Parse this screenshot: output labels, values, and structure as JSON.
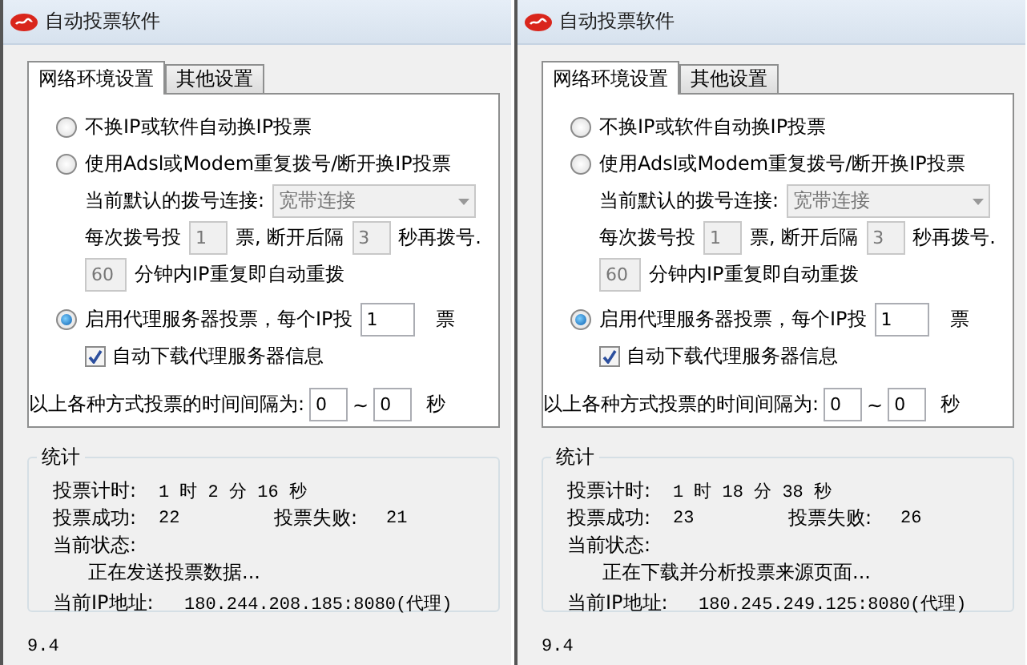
{
  "windows": [
    {
      "title": "自动投票软件",
      "tabs": [
        {
          "label": "网络环境设置",
          "selected": true
        },
        {
          "label": "其他设置",
          "selected": false
        }
      ],
      "no_change_option": {
        "label": "不换IP或软件自动换IP投票",
        "selected": false
      },
      "dialup_option": {
        "label": "使用Adsl或Modem重复拨号/断开换IP投票",
        "selected": false,
        "connection_label": "当前默认的拨号连接:",
        "connection": {
          "value": "宽带连接",
          "disabled": true
        },
        "votes_label": "每次拨号投",
        "votes": {
          "value": "1",
          "disabled": true
        },
        "after_label": "票, 断开后隔",
        "wait": {
          "value": "3",
          "disabled": true
        },
        "wait_label": "秒再拨号.",
        "repeat": {
          "value": "60",
          "disabled": true
        },
        "repeat_label": "分钟内IP重复即自动重拨"
      },
      "proxy_option": {
        "label": "启用代理服务器投票，每个IP投",
        "selected": true,
        "votes": {
          "value": "1",
          "disabled": false
        },
        "votes_unit": "票",
        "auto_download": {
          "label": "自动下载代理服务器信息",
          "checked": true
        }
      },
      "interval": {
        "label": "以上各种方式投票的时间间隔为:",
        "min": "0",
        "separator": "~",
        "max": "0",
        "unit": "秒"
      },
      "stats": {
        "title": "统计",
        "time_label": "投票计时:",
        "time_value": "1 时 2 分 16 秒",
        "success_label": "投票成功:",
        "success_value": "22",
        "fail_label": "投票失败:",
        "fail_value": "21",
        "status_label": "当前状态:",
        "status_value": "正在发送投票数据...",
        "ip_label": "当前IP地址:",
        "ip_value": "180.244.208.185:8080(代理)"
      },
      "version": "9.4"
    },
    {
      "title": "自动投票软件",
      "tabs": [
        {
          "label": "网络环境设置",
          "selected": true
        },
        {
          "label": "其他设置",
          "selected": false
        }
      ],
      "no_change_option": {
        "label": "不换IP或软件自动换IP投票",
        "selected": false
      },
      "dialup_option": {
        "label": "使用Adsl或Modem重复拨号/断开换IP投票",
        "selected": false,
        "connection_label": "当前默认的拨号连接:",
        "connection": {
          "value": "宽带连接",
          "disabled": true
        },
        "votes_label": "每次拨号投",
        "votes": {
          "value": "1",
          "disabled": true
        },
        "after_label": "票, 断开后隔",
        "wait": {
          "value": "3",
          "disabled": true
        },
        "wait_label": "秒再拨号.",
        "repeat": {
          "value": "60",
          "disabled": true
        },
        "repeat_label": "分钟内IP重复即自动重拨"
      },
      "proxy_option": {
        "label": "启用代理服务器投票，每个IP投",
        "selected": true,
        "votes": {
          "value": "1",
          "disabled": false
        },
        "votes_unit": "票",
        "auto_download": {
          "label": "自动下载代理服务器信息",
          "checked": true
        }
      },
      "interval": {
        "label": "以上各种方式投票的时间间隔为:",
        "min": "0",
        "separator": "~",
        "max": "0",
        "unit": "秒"
      },
      "stats": {
        "title": "统计",
        "time_label": "投票计时:",
        "time_value": "1 时 18 分 38 秒",
        "success_label": "投票成功:",
        "success_value": "23",
        "fail_label": "投票失败:",
        "fail_value": "26",
        "status_label": "当前状态:",
        "status_value": "正在下载并分析投票来源页面...",
        "ip_label": "当前IP地址:",
        "ip_value": "180.245.249.125:8080(代理)"
      },
      "version": "9.4"
    }
  ]
}
